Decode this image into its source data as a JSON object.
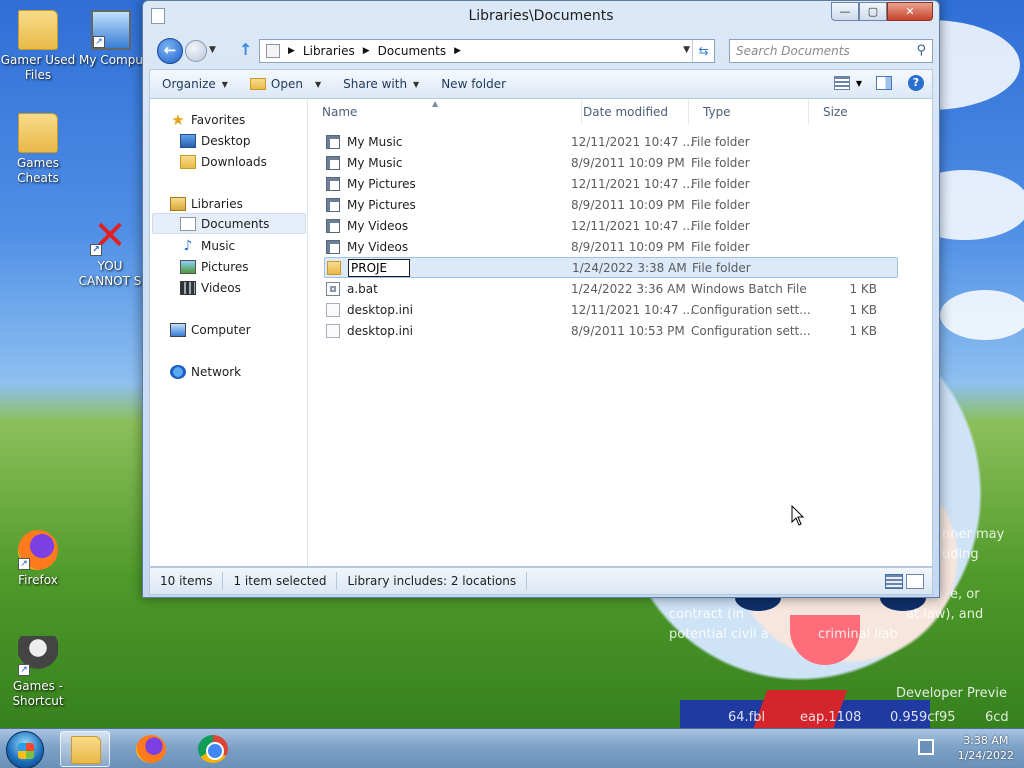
{
  "desktop": {
    "icons": [
      {
        "label": "Gamer Used Files"
      },
      {
        "label": "My Compu"
      },
      {
        "label": "Games Cheats"
      },
      {
        "label": "YOU CANNOT S"
      },
      {
        "label": "Firefox"
      },
      {
        "label": "Games - Shortcut"
      }
    ],
    "watermark_lines": [
      "nner may",
      "uding",
      "e, or",
      "contract (in",
      "at law), and",
      "potential civil a",
      "criminal liab",
      "Developer Previe",
      "64.fbl",
      "eap.1108",
      "0.959cf95",
      "6cd"
    ]
  },
  "window": {
    "title": "Libraries\\Documents",
    "buttons": {
      "minimize": "—",
      "maximize": "▢",
      "close": "✕"
    }
  },
  "address_bar": {
    "segments": [
      "Libraries",
      "Documents"
    ],
    "search_placeholder": "Search Documents"
  },
  "toolbar": {
    "organize": "Organize",
    "open": "Open",
    "share_with": "Share with",
    "new_folder": "New folder"
  },
  "nav_pane": {
    "favorites": "Favorites",
    "desktop": "Desktop",
    "downloads": "Downloads",
    "libraries": "Libraries",
    "documents": "Documents",
    "music": "Music",
    "pictures": "Pictures",
    "videos": "Videos",
    "computer": "Computer",
    "network": "Network"
  },
  "columns": {
    "name": "Name",
    "date_modified": "Date modified",
    "type": "Type",
    "size": "Size"
  },
  "files": [
    {
      "name": "My Music",
      "date": "12/11/2021 10:47 ...",
      "type": "File folder",
      "size": ""
    },
    {
      "name": "My Music",
      "date": "8/9/2011 10:09 PM",
      "type": "File folder",
      "size": ""
    },
    {
      "name": "My Pictures",
      "date": "12/11/2021 10:47 ...",
      "type": "File folder",
      "size": ""
    },
    {
      "name": "My Pictures",
      "date": "8/9/2011 10:09 PM",
      "type": "File folder",
      "size": ""
    },
    {
      "name": "My Videos",
      "date": "12/11/2021 10:47 ...",
      "type": "File folder",
      "size": ""
    },
    {
      "name": "My Videos",
      "date": "8/9/2011 10:09 PM",
      "type": "File folder",
      "size": ""
    },
    {
      "name": "PROJE",
      "date": "1/24/2022 3:38 AM",
      "type": "File folder",
      "size": ""
    },
    {
      "name": "a.bat",
      "date": "1/24/2022 3:36 AM",
      "type": "Windows Batch File",
      "size": "1 KB"
    },
    {
      "name": "desktop.ini",
      "date": "12/11/2021 10:47 ...",
      "type": "Configuration sett...",
      "size": "1 KB"
    },
    {
      "name": "desktop.ini",
      "date": "8/9/2011 10:53 PM",
      "type": "Configuration sett...",
      "size": "1 KB"
    }
  ],
  "status": {
    "count": "10 items",
    "selected": "1 item selected",
    "library": "Library includes: 2 locations"
  },
  "taskbar": {
    "time": "3:38 AM",
    "date": "1/24/2022"
  }
}
